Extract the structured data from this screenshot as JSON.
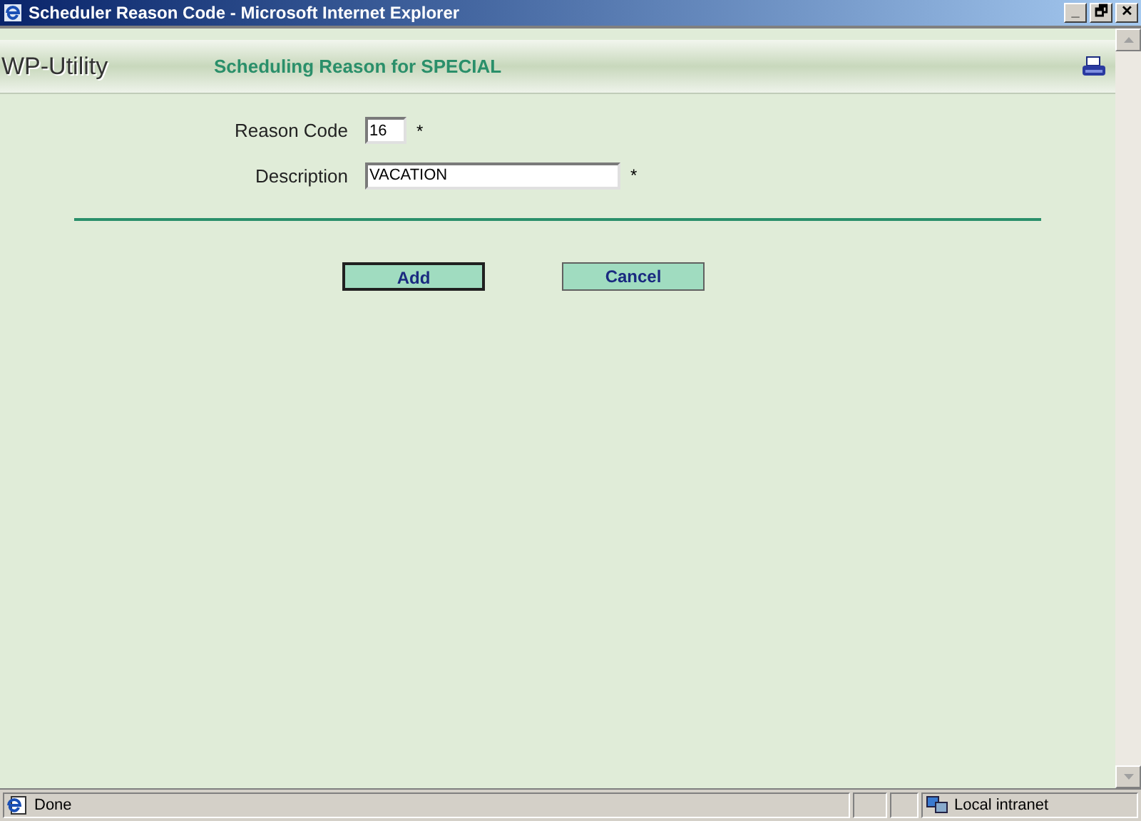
{
  "window": {
    "title": "Scheduler Reason Code - Microsoft Internet Explorer",
    "controls": [
      "_",
      "🗗",
      "✕"
    ]
  },
  "header": {
    "app_name": "WP-Utility",
    "heading": "Scheduling Reason for SPECIAL"
  },
  "form": {
    "fields": [
      {
        "label": "Reason Code",
        "value": "16",
        "required_mark": "*",
        "kind": "short"
      },
      {
        "label": "Description",
        "value": "VACATION",
        "required_mark": "*",
        "kind": "long"
      }
    ]
  },
  "buttons": [
    {
      "label": "Add",
      "focused": true
    },
    {
      "label": "Cancel",
      "focused": false
    }
  ],
  "status_bar": {
    "status": "Done",
    "zone": "Local intranet"
  }
}
